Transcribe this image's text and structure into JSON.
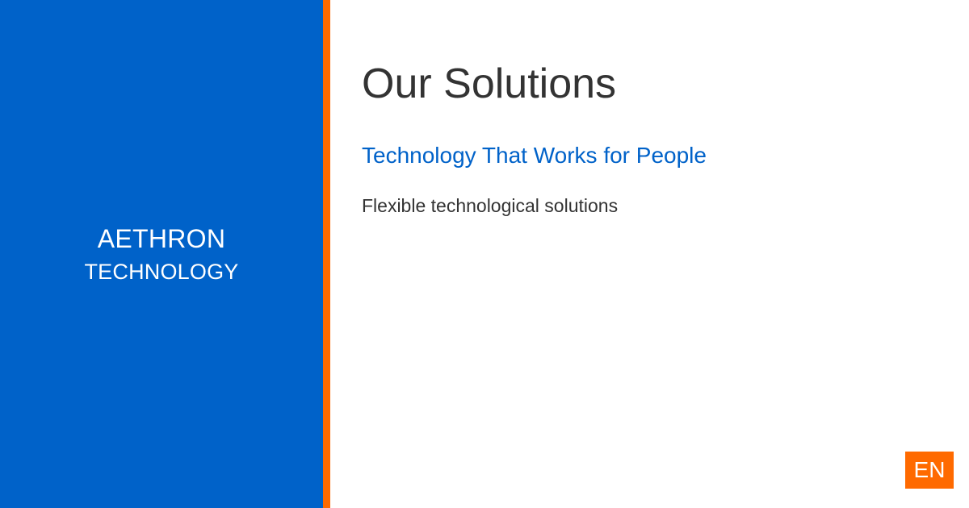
{
  "brand": {
    "name_line1": "AETHRON",
    "name_line2": "TECHNOLOGY"
  },
  "main": {
    "title": "Our Solutions",
    "subtitle": "Technology That Works for People",
    "description": "Flexible technological solutions"
  },
  "language": {
    "label": "EN"
  },
  "colors": {
    "brand_blue": "#0062c9",
    "accent_orange": "#ff6a00",
    "text_dark": "#333333",
    "background": "#ffffff"
  }
}
